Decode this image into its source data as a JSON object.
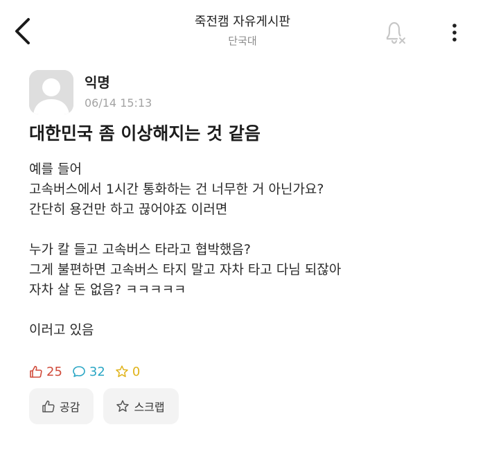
{
  "header": {
    "title": "죽전캠 자유게시판",
    "subtitle": "단국대",
    "back_icon": "chevron-left-icon",
    "bell_icon": "bell-off-icon",
    "more_icon": "more-vertical-icon"
  },
  "post": {
    "author": "익명",
    "date": "06/14 15:13",
    "title": "대한민국 좀 이상해지는 것 같음",
    "body_lines": [
      "예를 들어",
      "고속버스에서 1시간 통화하는 건 너무한 거 아닌가요?",
      "간단히 용건만 하고 끊어야죠 이러면",
      "",
      "누가 칼 들고 고속버스 타라고 협박했음?",
      "그게 불편하면 고속버스 타지 말고 자차 타고 다님 되잖아",
      "자차 살 돈 없음? ㅋㅋㅋㅋㅋ",
      "",
      "이러고 있음"
    ]
  },
  "stats": {
    "likes": "25",
    "comments": "32",
    "scraps": "0"
  },
  "actions": {
    "like_label": "공감",
    "scrap_label": "스크랩"
  },
  "colors": {
    "like": "#d04a3a",
    "comment": "#2aa6c4",
    "scrap": "#e0b31a",
    "muted": "#a3a3a3"
  }
}
